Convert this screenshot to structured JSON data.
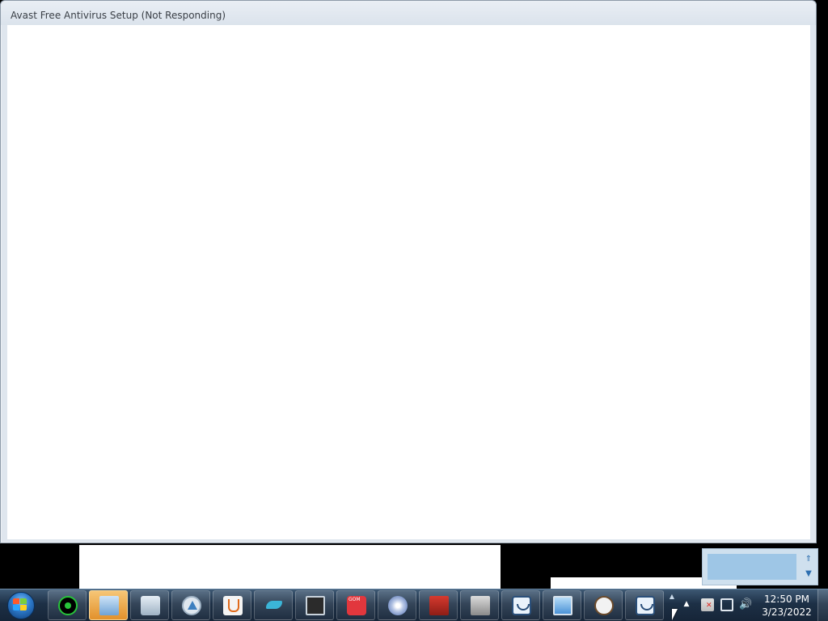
{
  "window": {
    "title": "Avast Free Antivirus Setup (Not Responding)"
  },
  "taskbar": {
    "start_button_icon": "windows-start-orb-icon",
    "buttons": [
      {
        "name": "green-flower-app",
        "icon": "green-flower-icon",
        "active": false
      },
      {
        "name": "installer-app",
        "icon": "installer-computer-icon",
        "active": true
      },
      {
        "name": "gear-app",
        "icon": "application-gear-icon",
        "active": false
      },
      {
        "name": "triangle-app",
        "icon": "triangle-logo-icon",
        "active": false
      },
      {
        "name": "java-app",
        "icon": "java-cup-icon",
        "active": false
      },
      {
        "name": "bird-app",
        "icon": "hummingbird-icon",
        "active": false
      },
      {
        "name": "terminal-installer-app",
        "icon": "terminal-installer-icon",
        "active": false
      },
      {
        "name": "gom-player-app",
        "icon": "gom-player-icon",
        "active": false
      },
      {
        "name": "disc-app",
        "icon": "disc-icon",
        "active": false
      },
      {
        "name": "red-box-app",
        "icon": "red-box-icon",
        "active": false
      },
      {
        "name": "printer-app",
        "icon": "printer-icon",
        "active": false
      },
      {
        "name": "blue-arc-app-1",
        "icon": "blue-arc-icon",
        "active": false
      },
      {
        "name": "monitor-app",
        "icon": "monitor-icon",
        "active": false
      },
      {
        "name": "cow-app",
        "icon": "cow-icon",
        "active": false
      },
      {
        "name": "blue-arc-app-2",
        "icon": "blue-arc-icon",
        "active": false
      }
    ],
    "tray": {
      "show_hidden_arrow": "▲",
      "icons": [
        "action-center-flag-icon",
        "network-icon",
        "volume-icon"
      ],
      "volume_glyph": "🔊",
      "time": "12:50 PM",
      "date": "3/23/2022"
    }
  },
  "notification_popup": {
    "up_arrow": "⇑",
    "down_arrow": "▼"
  },
  "colors": {
    "taskbar": "#1d3046",
    "window_frame": "#dfe6ee",
    "client_bg": "#ffffff",
    "active_button": "#e2912c"
  }
}
